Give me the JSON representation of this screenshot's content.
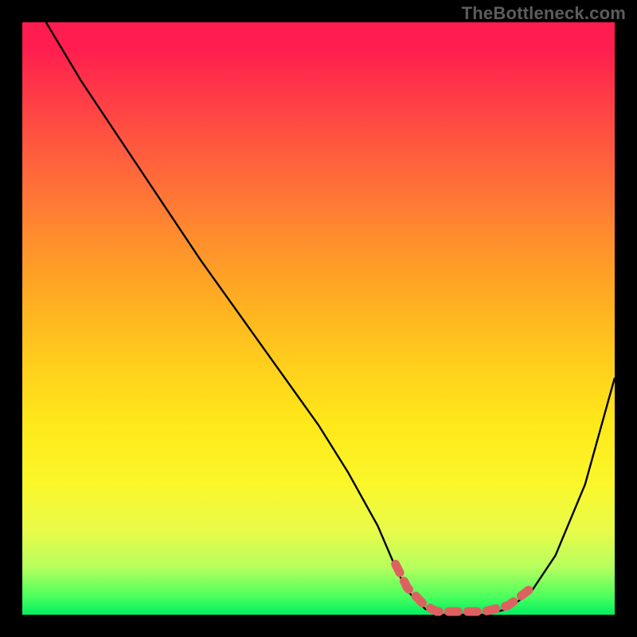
{
  "watermark": "TheBottleneck.com",
  "chart_data": {
    "type": "line",
    "title": "",
    "xlabel": "",
    "ylabel": "",
    "xlim": [
      0,
      100
    ],
    "ylim": [
      0,
      100
    ],
    "grid": false,
    "series": [
      {
        "name": "bottleneck-curve",
        "x": [
          4,
          10,
          20,
          30,
          40,
          50,
          55,
          60,
          63,
          65,
          68,
          70,
          74,
          78,
          82,
          86,
          90,
          95,
          100
        ],
        "values": [
          100,
          90,
          75,
          60,
          46,
          32,
          24,
          15,
          8,
          4,
          1,
          0,
          0,
          0,
          1,
          4,
          10,
          22,
          40
        ]
      }
    ],
    "annotations": [
      {
        "name": "optimal-range",
        "x_start": 63,
        "x_end": 86,
        "style": "dashed-red-band",
        "color": "#de6161"
      }
    ],
    "background_gradient": {
      "top": "#ff1c4f",
      "bottom": "#00f060",
      "stops": [
        {
          "t": 0.0,
          "c": "#ff1c4f"
        },
        {
          "t": 0.3,
          "c": "#ff8c2e"
        },
        {
          "t": 0.6,
          "c": "#ffe21a"
        },
        {
          "t": 0.9,
          "c": "#b6ff5e"
        },
        {
          "t": 1.0,
          "c": "#00f060"
        }
      ]
    }
  }
}
